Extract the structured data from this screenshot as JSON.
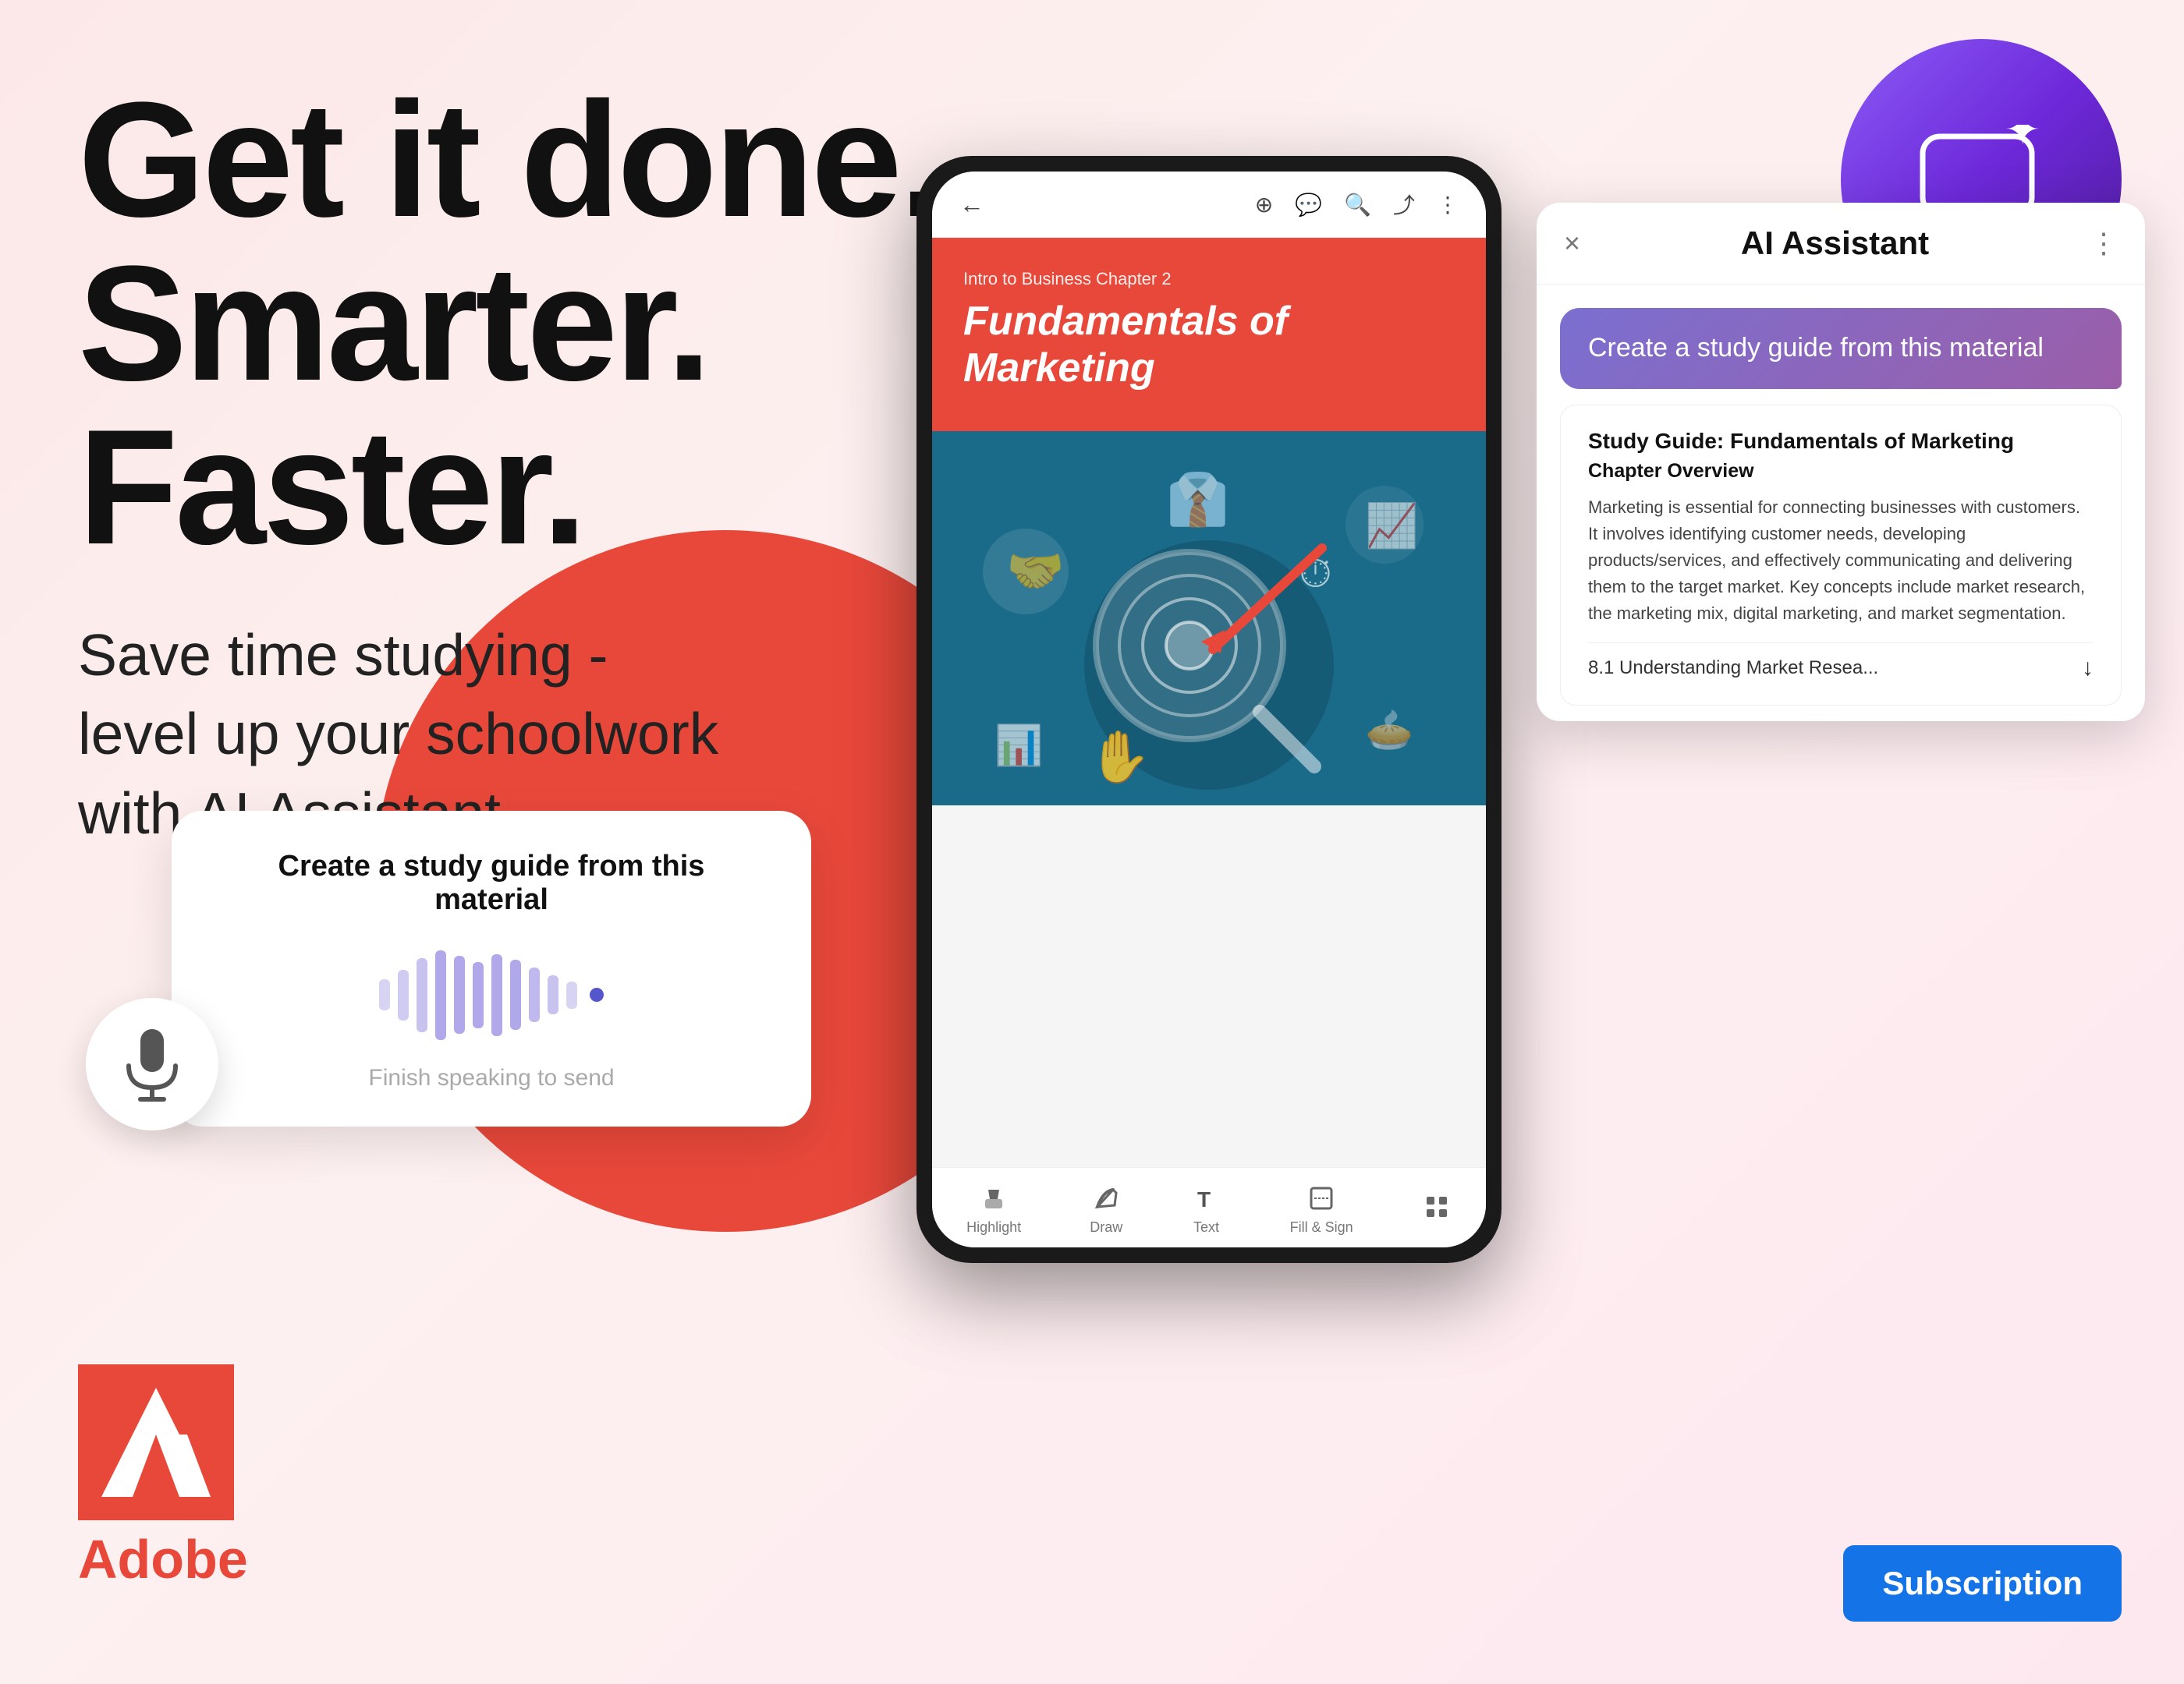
{
  "headline": {
    "line1": "Get it done.",
    "line2": "Smarter. Faster."
  },
  "subtitle": "Save time studying -\nlevel up your schoolwork\nwith AI Assistant",
  "voice_card": {
    "title": "Create a study guide from this material",
    "hint": "Finish speaking to send"
  },
  "ai_panel": {
    "title": "AI Assistant",
    "close_label": "×",
    "more_label": "⋮",
    "user_message": "Create a study guide from this material",
    "response": {
      "title": "Study Guide: Fundamentals of Marketing",
      "chapter_title": "Chapter Overview",
      "body": "Marketing is essential for connecting businesses with customers. It involves identifying customer needs, developing products/services, and effectively communicating and delivering them to the target market. Key concepts include market research, the marketing mix, digital marketing, and market segmentation.",
      "section_link": "8.1 Understanding Market Resea..."
    }
  },
  "document": {
    "subtitle": "Intro to Business Chapter 2",
    "title": "Fundamentals of Marketing"
  },
  "phone_toolbar": {
    "tools": [
      {
        "icon": "💬",
        "label": "Highlight"
      },
      {
        "icon": "✏️",
        "label": "Draw"
      },
      {
        "icon": "T",
        "label": "Text"
      },
      {
        "icon": "⬜",
        "label": "Fill & Sign"
      },
      {
        "icon": "⊞",
        "label": ""
      }
    ]
  },
  "adobe": {
    "text": "Adobe"
  },
  "subscription": {
    "label": "Subscription"
  },
  "colors": {
    "adobe_red": "#e8483a",
    "subscription_blue": "#1473E6",
    "purple_start": "#8b5cf6",
    "purple_end": "#4c1d95",
    "bubble_gradient_start": "#7b6fd0",
    "bubble_gradient_end": "#9b5ea8"
  }
}
